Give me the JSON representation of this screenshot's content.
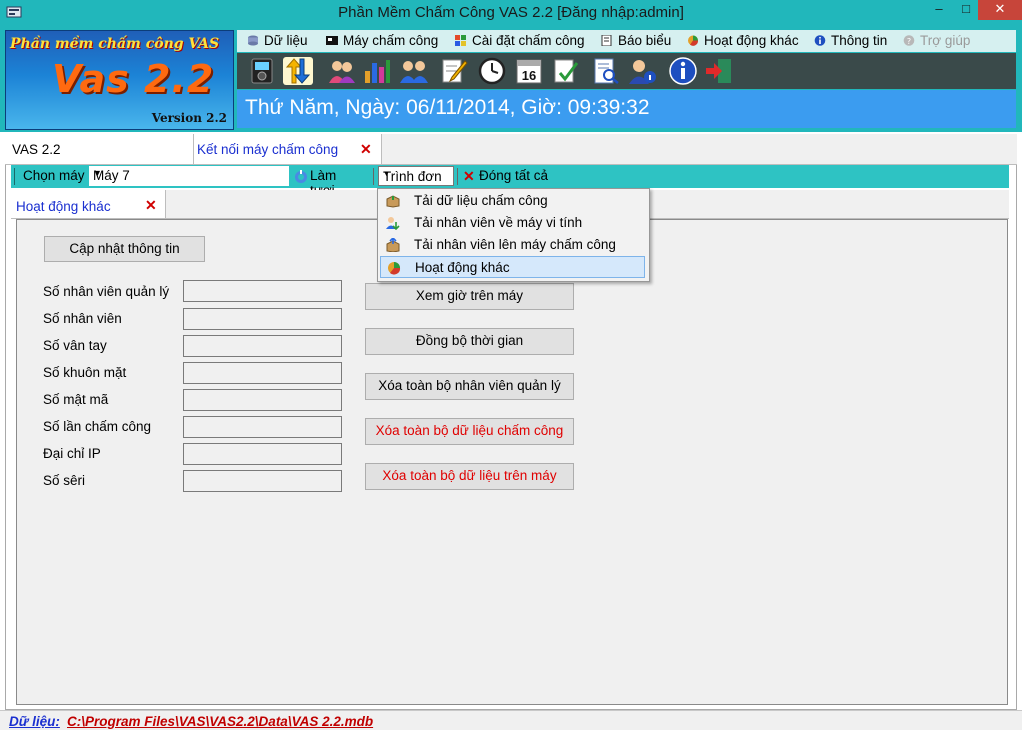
{
  "window": {
    "title": "Phần Mềm Chấm Công VAS 2.2 [Đăng nhập:admin]",
    "minimize": "–",
    "maximize": "□",
    "close": "✕"
  },
  "logo": {
    "line1": "Phần mềm chấm công VAS",
    "line2": "Vas 2.2",
    "line3": "Version 2.2"
  },
  "menubar": {
    "items": [
      {
        "label": "Dữ liệu",
        "icon": "database-icon",
        "enabled": true
      },
      {
        "label": "Máy chấm công",
        "icon": "device-icon",
        "enabled": true
      },
      {
        "label": "Cài đặt chấm công",
        "icon": "grid-icon",
        "enabled": true
      },
      {
        "label": "Báo biểu",
        "icon": "report-icon",
        "enabled": true
      },
      {
        "label": "Hoạt động khác",
        "icon": "pie-icon",
        "enabled": true
      },
      {
        "label": "Thông tin",
        "icon": "info-icon",
        "enabled": true
      },
      {
        "label": "Trợ giúp",
        "icon": "help-icon",
        "enabled": false
      }
    ]
  },
  "toolbar": {
    "buttons": [
      "fingerprint-device-icon",
      "transfer-arrows-icon",
      "users-icon",
      "chart-icon",
      "employees-icon",
      "edit-note-icon",
      "clock-icon",
      "calendar-16-icon",
      "approve-icon",
      "report-search-icon",
      "user-info-icon",
      "info-icon",
      "exit-icon"
    ],
    "calendar_day": "16"
  },
  "datebar": {
    "text": "Thứ Năm, Ngày: 06/11/2014, Giờ: 09:39:32"
  },
  "tabs": {
    "main": "VAS 2.2",
    "connect": "Kết nối máy chấm công",
    "close": "✕"
  },
  "connbar": {
    "choose_label": "Chọn máy",
    "selected_device": "Máy 7",
    "refresh": "Làm tươi",
    "menu": "Trình đơn",
    "close_all": "Đóng tất cả",
    "arrow": "▼"
  },
  "inner_tab": {
    "label": "Hoạt động khác",
    "close": "✕"
  },
  "dropdown": {
    "items": [
      {
        "label": "Tải dữ liệu chấm công",
        "icon": "box-icon"
      },
      {
        "label": "Tải nhân viên về máy vi tính",
        "icon": "user-download-icon"
      },
      {
        "label": "Tải nhân viên lên máy chấm công",
        "icon": "box-upload-icon"
      },
      {
        "label": "Hoạt động khác",
        "icon": "pie-icon"
      }
    ],
    "selected": "Hoạt động khác"
  },
  "panel": {
    "update_button": "Cập nhật thông tin",
    "fields": [
      {
        "label": "Số nhân viên quản lý",
        "value": ""
      },
      {
        "label": "Số nhân viên",
        "value": ""
      },
      {
        "label": "Số vân tay",
        "value": ""
      },
      {
        "label": "Số khuôn mặt",
        "value": ""
      },
      {
        "label": "Số mật mã",
        "value": ""
      },
      {
        "label": "Số lần chấm công",
        "value": ""
      },
      {
        "label": "Đại chỉ IP",
        "value": ""
      },
      {
        "label": "Số sêri",
        "value": ""
      }
    ],
    "actions": [
      {
        "label": "Xem giờ trên máy",
        "danger": false
      },
      {
        "label": "Đồng bộ thời gian",
        "danger": false
      },
      {
        "label": "Xóa toàn bộ nhân viên quản lý",
        "danger": false
      },
      {
        "label": "Xóa toàn bộ dữ liệu chấm công",
        "danger": true
      },
      {
        "label": "Xóa toàn bộ dữ liệu trên máy",
        "danger": true
      }
    ]
  },
  "status": {
    "key": "Dữ liệu:",
    "path": "C:\\Program Files\\VAS\\VAS2.2\\Data\\VAS 2.2.mdb"
  },
  "colors": {
    "teal": "#21b7bb",
    "accent_bar": "#3b9cf0",
    "link_blue": "#1a2fd0",
    "danger": "#e00000"
  }
}
